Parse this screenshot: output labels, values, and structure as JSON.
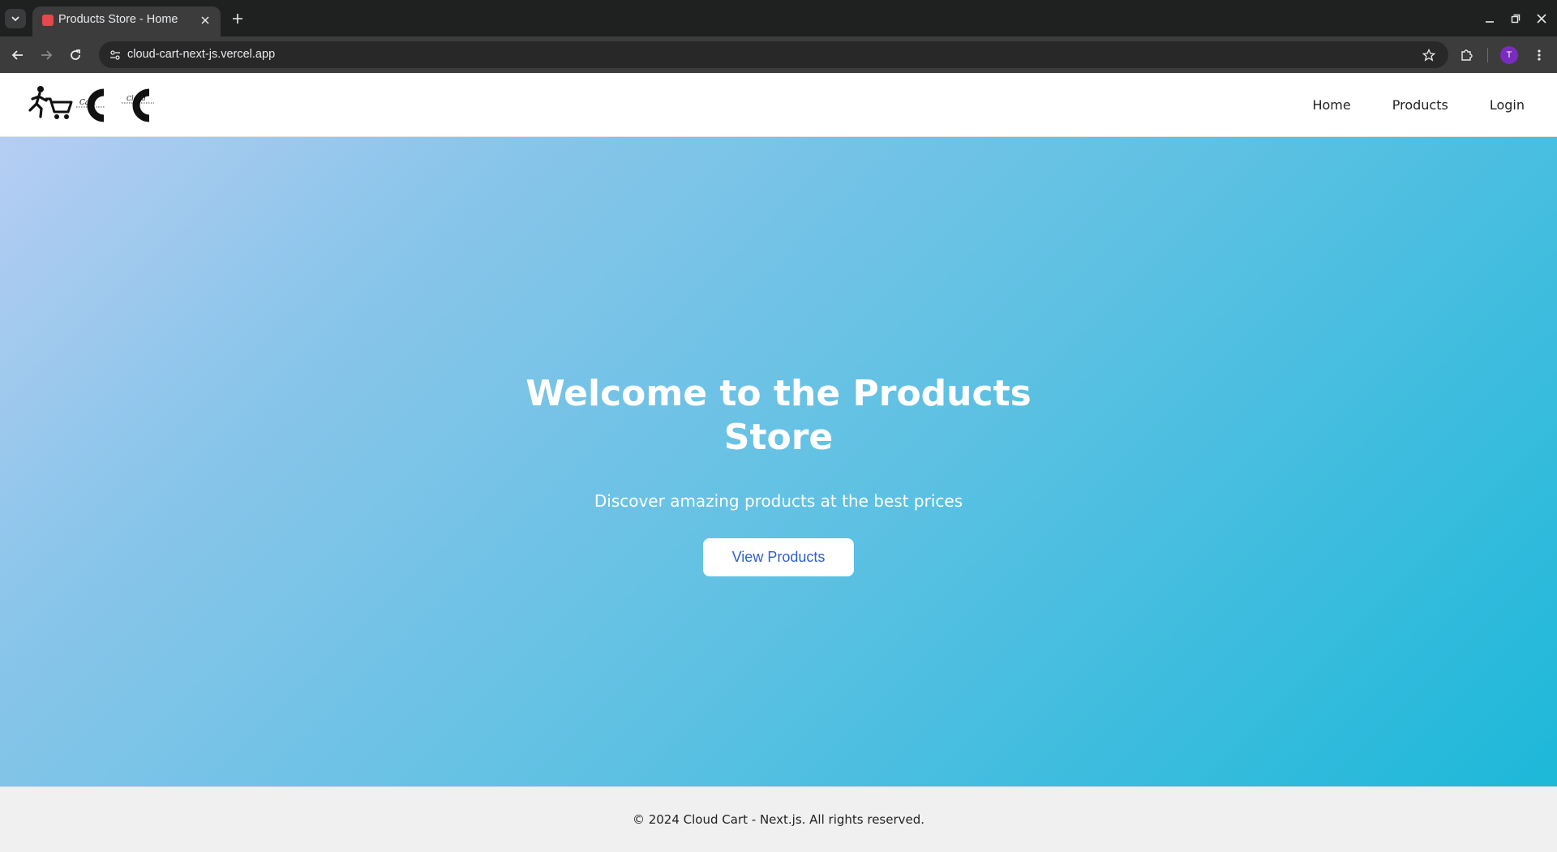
{
  "browser": {
    "tab_title": "Products Store - Home",
    "url": "cloud-cart-next-js.vercel.app",
    "profile_initial": "T"
  },
  "header": {
    "logo_text": [
      "Cart",
      "Cloud"
    ],
    "nav": {
      "home": "Home",
      "products": "Products",
      "login": "Login"
    }
  },
  "hero": {
    "title_line1": "Welcome to the Products",
    "title_line2": "Store",
    "subtitle": "Discover amazing products at the best prices",
    "cta_label": "View Products"
  },
  "footer": {
    "text": "© 2024 Cloud Cart - Next.js. All rights reserved."
  },
  "colors": {
    "hero_gradient_start": "#b6cdf3",
    "hero_gradient_end": "#1db8d9",
    "cta_text": "#2f5fd0"
  }
}
